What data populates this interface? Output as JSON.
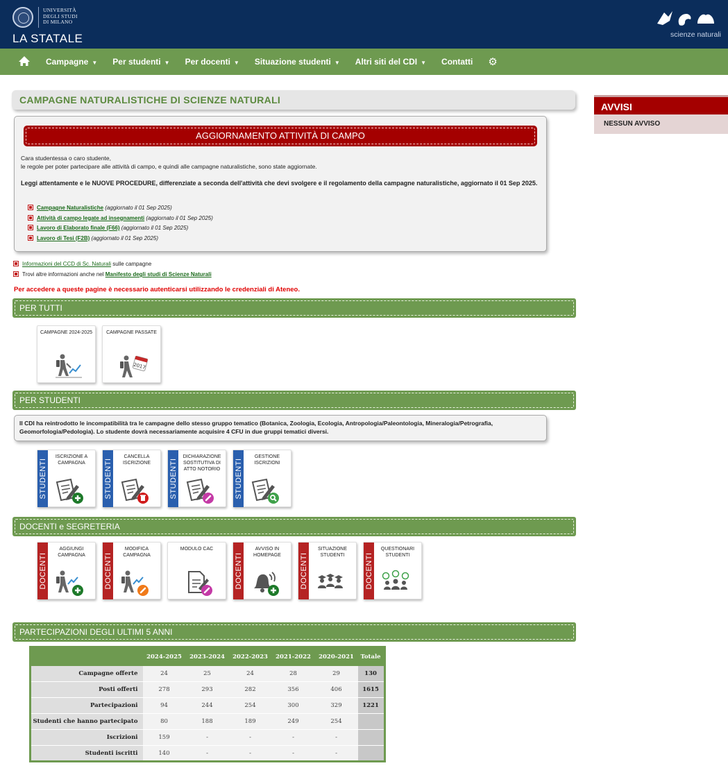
{
  "header": {
    "uni_name_lines": [
      "UNIVERSITÀ",
      "DEGLI STUDI",
      "DI MILANO"
    ],
    "brand": "LA STATALE",
    "dept_logo_text": "scienze naturali"
  },
  "nav": {
    "items": [
      {
        "label": "Campagne",
        "dropdown": true
      },
      {
        "label": "Per studenti",
        "dropdown": true
      },
      {
        "label": "Per docenti",
        "dropdown": true
      },
      {
        "label": "Situazione studenti",
        "dropdown": true
      },
      {
        "label": "Altri siti del CDI",
        "dropdown": true
      },
      {
        "label": "Contatti",
        "dropdown": false
      }
    ],
    "caret": "▼",
    "gear": "⚙"
  },
  "page_title": "CAMPAGNE NATURALISTICHE DI SCIENZE NATURALI",
  "sidebar": {
    "title": "AVVISI",
    "empty": "NESSUN AVVISO"
  },
  "notice": {
    "title": "AGGIORNAMENTO ATTIVITÀ DI CAMPO",
    "p1_line1": "Cara studentessa o caro studente,",
    "p1_line2": "le regole per poter partecipare alle attività di campo, e quindi alle campagne naturalistiche, sono state aggiornate.",
    "p2": "Leggi attentamente e le NUOVE PROCEDURE, differenziate a seconda dell'attività che devi svolgere e il regolamento della campagne naturalistiche, aggiornato il 01 Sep 2025.",
    "links": [
      {
        "label": "Campagne Naturalistiche",
        "note": " (aggiornato il 01 Sep 2025)"
      },
      {
        "label": "Attività di campo legate ad insegnamenti",
        "note": " (aggiornato il 01 Sep 2025)"
      },
      {
        "label": "Lavoro di Elaborato finale (F66)",
        "note": " (aggiornato il 01 Sep 2025)"
      },
      {
        "label": "Lavoro di Tesi (F2B)",
        "note": " (aggiornato il 01 Sep 2025)"
      }
    ]
  },
  "extra": {
    "line1_link": "Informazioni del CCD di Sc. Naturali",
    "line1_rest": " sulle campagne",
    "line2_pre": "Trovi altre informazioni anche nel ",
    "line2_link": "Manifesto degli studi di Scienze Naturali"
  },
  "auth_warning": "Per accedere a queste pagine è necessario autenticarsi utilizzando le credenziali di Ateneo.",
  "sections": {
    "per_tutti": "PER TUTTI",
    "per_studenti": "PER STUDENTI",
    "docenti": "DOCENTI e SEGRETERIA",
    "partecipazioni": "PARTECIPAZIONI DEGLI ULTIMI 5 ANNI"
  },
  "tiles_tutti": [
    {
      "label": "CAMPAGNE 2024-2025"
    },
    {
      "label": "CAMPAGNE PASSATE",
      "badge": "2017"
    }
  ],
  "studenti_info": "Il CDI ha reintrodotto le incompatibilità tra le campagne dello stesso gruppo tematico (Botanica, Zoologia, Ecologia, Antropologia/Paleontologia, Mineralogia/Petrografia, Geomorfologia/Pedologia). Lo studente dovrà necessariamente acquisire 4 CFU in due gruppi tematici diversi.",
  "tag_studenti": "STUDENTI",
  "tag_docenti": "DOCENTI",
  "tiles_studenti": [
    {
      "label": "ISCRIZIONE A CAMPAGNA",
      "badge_color": "#1e7a2a",
      "badge_icon": "plus-icon"
    },
    {
      "label": "CANCELLA ISCRIZIONE",
      "badge_color": "#d01c1c",
      "badge_icon": "trash-icon"
    },
    {
      "label": "DICHIARAZIONE SOSTITUTIVA DI ATTO NOTORIO",
      "badge_color": "#c43aa6",
      "badge_icon": "link-icon"
    },
    {
      "label": "GESTIONE ISCRIZIONI",
      "badge_color": "#3fa14a",
      "badge_icon": "magnifier-icon"
    }
  ],
  "tiles_docenti": [
    {
      "label": "AGGIUNGI CAMPAGNA",
      "tag": true
    },
    {
      "label": "MODIFICA CAMPAGNA",
      "tag": true
    },
    {
      "label": "MODULO CAC",
      "tag": false
    },
    {
      "label": "AVVISO IN HOMEPAGE",
      "tag": true
    },
    {
      "label": "SITUAZIONE STUDENTI",
      "tag": true
    },
    {
      "label": "QUESTIONARI STUDENTI",
      "tag": true
    }
  ],
  "table": {
    "columns": [
      "",
      "2024-2025",
      "2023-2024",
      "2022-2023",
      "2021-2022",
      "2020-2021",
      "Totale"
    ],
    "rows": [
      [
        "Campagne offerte",
        "24",
        "25",
        "24",
        "28",
        "29",
        "130"
      ],
      [
        "Posti offerti",
        "278",
        "293",
        "282",
        "356",
        "406",
        "1615"
      ],
      [
        "Partecipazioni",
        "94",
        "244",
        "254",
        "300",
        "329",
        "1221"
      ],
      [
        "Studenti che hanno partecipato",
        "80",
        "188",
        "189",
        "249",
        "254",
        ""
      ],
      [
        "Iscrizioni",
        "159",
        "-",
        "-",
        "-",
        "-",
        ""
      ],
      [
        "Studenti iscritti",
        "140",
        "-",
        "-",
        "-",
        "-",
        ""
      ]
    ]
  },
  "colors": {
    "header_blue": "#0b2d5b",
    "nav_green": "#6e9a50",
    "accent_red": "#a40000",
    "studenti_blue": "#2a5fae",
    "docenti_red": "#b52323"
  }
}
